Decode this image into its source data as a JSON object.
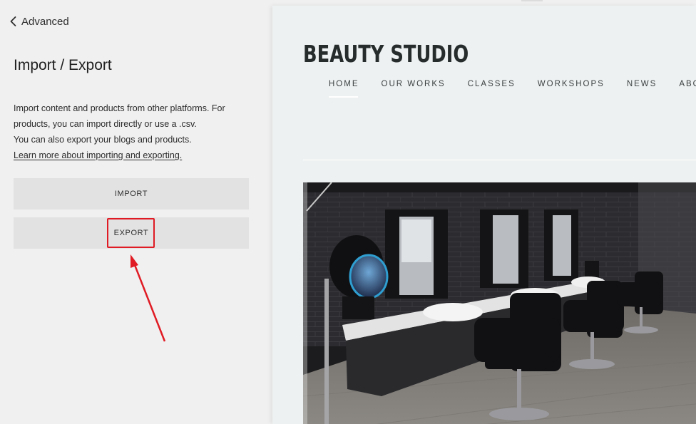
{
  "panel": {
    "back_label": "Advanced",
    "title": "Import / Export",
    "desc_line1": "Import content and products from other platforms. For products, you can import directly or use a .csv.",
    "desc_line2": "You can also export your blogs and products.",
    "desc_link": "Learn more about importing and exporting.",
    "import_label": "IMPORT",
    "export_label": "EXPORT",
    "annotation_color": "#e01b24"
  },
  "preview": {
    "site_title": "BEAUTY STUDIO",
    "nav": [
      "HOME",
      "OUR WORKS",
      "CLASSES",
      "WORKSHOPS",
      "NEWS",
      "ABOUT"
    ],
    "active_nav": "HOME"
  }
}
